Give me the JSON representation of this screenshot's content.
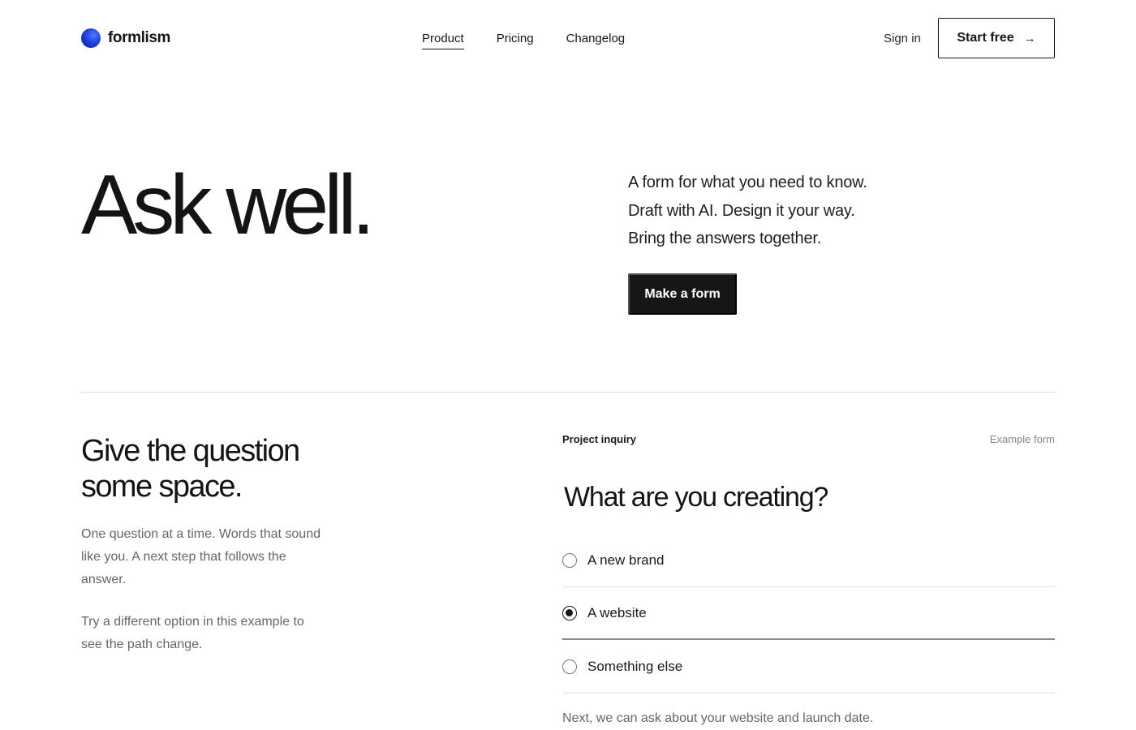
{
  "brand": {
    "name": "formlism",
    "logo_icon": "gradient-orb-icon",
    "accent": "#1f3fe0"
  },
  "nav": {
    "items": [
      {
        "label": "Product",
        "active": true
      },
      {
        "label": "Pricing",
        "active": false
      },
      {
        "label": "Changelog",
        "active": false
      }
    ],
    "sign_in": "Sign in",
    "start_free": "Start free",
    "start_free_icon": "arrow-right-icon"
  },
  "hero": {
    "title": "Ask well.",
    "lines": [
      "A form for what you need to know.",
      "Draft with AI. Design it your way.",
      "Bring the answers together."
    ],
    "cta": "Make a form"
  },
  "section": {
    "title": "Give the question some space.",
    "paragraph1": "One question at a time. Words that sound like you. A next step that follows the answer.",
    "paragraph2": "Try a different option in this example to see the path change."
  },
  "example_form": {
    "label": "Project inquiry",
    "meta": "Example form",
    "question": "What are you creating?",
    "options": [
      {
        "label": "A new brand",
        "selected": false
      },
      {
        "label": "A website",
        "selected": true
      },
      {
        "label": "Something else",
        "selected": false
      }
    ],
    "next_note": "Next, we can ask about your website and launch date."
  }
}
